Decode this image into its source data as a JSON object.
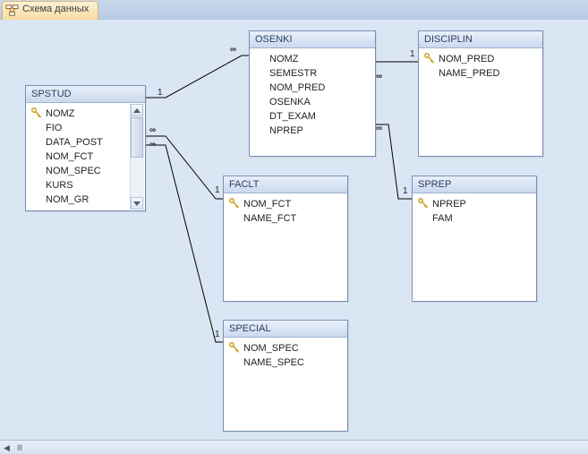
{
  "tab": {
    "title": "Схема данных"
  },
  "tables": {
    "spstud": {
      "title": "SPSTUD",
      "fields": [
        "NOMZ",
        "FIO",
        "DATA_POST",
        "NOM_FCT",
        "NOM_SPEC",
        "KURS",
        "NOM_GR"
      ],
      "primary_key": "NOMZ"
    },
    "osenki": {
      "title": "OSENKI",
      "fields": [
        "NOMZ",
        "SEMESTR",
        "NOM_PRED",
        "OSENKA",
        "DT_EXAM",
        "NPREP"
      ],
      "primary_key": null
    },
    "disciplin": {
      "title": "DISCIPLIN",
      "fields": [
        "NOM_PRED",
        "NAME_PRED"
      ],
      "primary_key": "NOM_PRED"
    },
    "faclt": {
      "title": "FACLT",
      "fields": [
        "NOM_FCT",
        "NAME_FCT"
      ],
      "primary_key": "NOM_FCT"
    },
    "sprep": {
      "title": "SPREP",
      "fields": [
        "NPREP",
        "FAM"
      ],
      "primary_key": "NPREP"
    },
    "special": {
      "title": "SPECIAL",
      "fields": [
        "NOM_SPEC",
        "NAME_SPEC"
      ],
      "primary_key": "NOM_SPEC"
    }
  },
  "relations": [
    {
      "from": "SPSTUD.NOMZ",
      "to": "OSENKI.NOMZ",
      "card_from": "1",
      "card_to": "∞"
    },
    {
      "from": "DISCIPLIN.NOM_PRED",
      "to": "OSENKI.NOM_PRED",
      "card_from": "1",
      "card_to": "∞"
    },
    {
      "from": "SPREP.NPREP",
      "to": "OSENKI.NPREP",
      "card_from": "1",
      "card_to": "∞"
    },
    {
      "from": "FACLT.NOM_FCT",
      "to": "SPSTUD.NOM_FCT",
      "card_from": "1",
      "card_to": "∞"
    },
    {
      "from": "SPECIAL.NOM_SPEC",
      "to": "SPSTUD.NOM_SPEC",
      "card_from": "1",
      "card_to": "∞"
    }
  ],
  "symbols": {
    "one": "1",
    "many": "∞"
  },
  "footer": {
    "left_arrow": "◀",
    "pipe": "Ⅲ"
  }
}
